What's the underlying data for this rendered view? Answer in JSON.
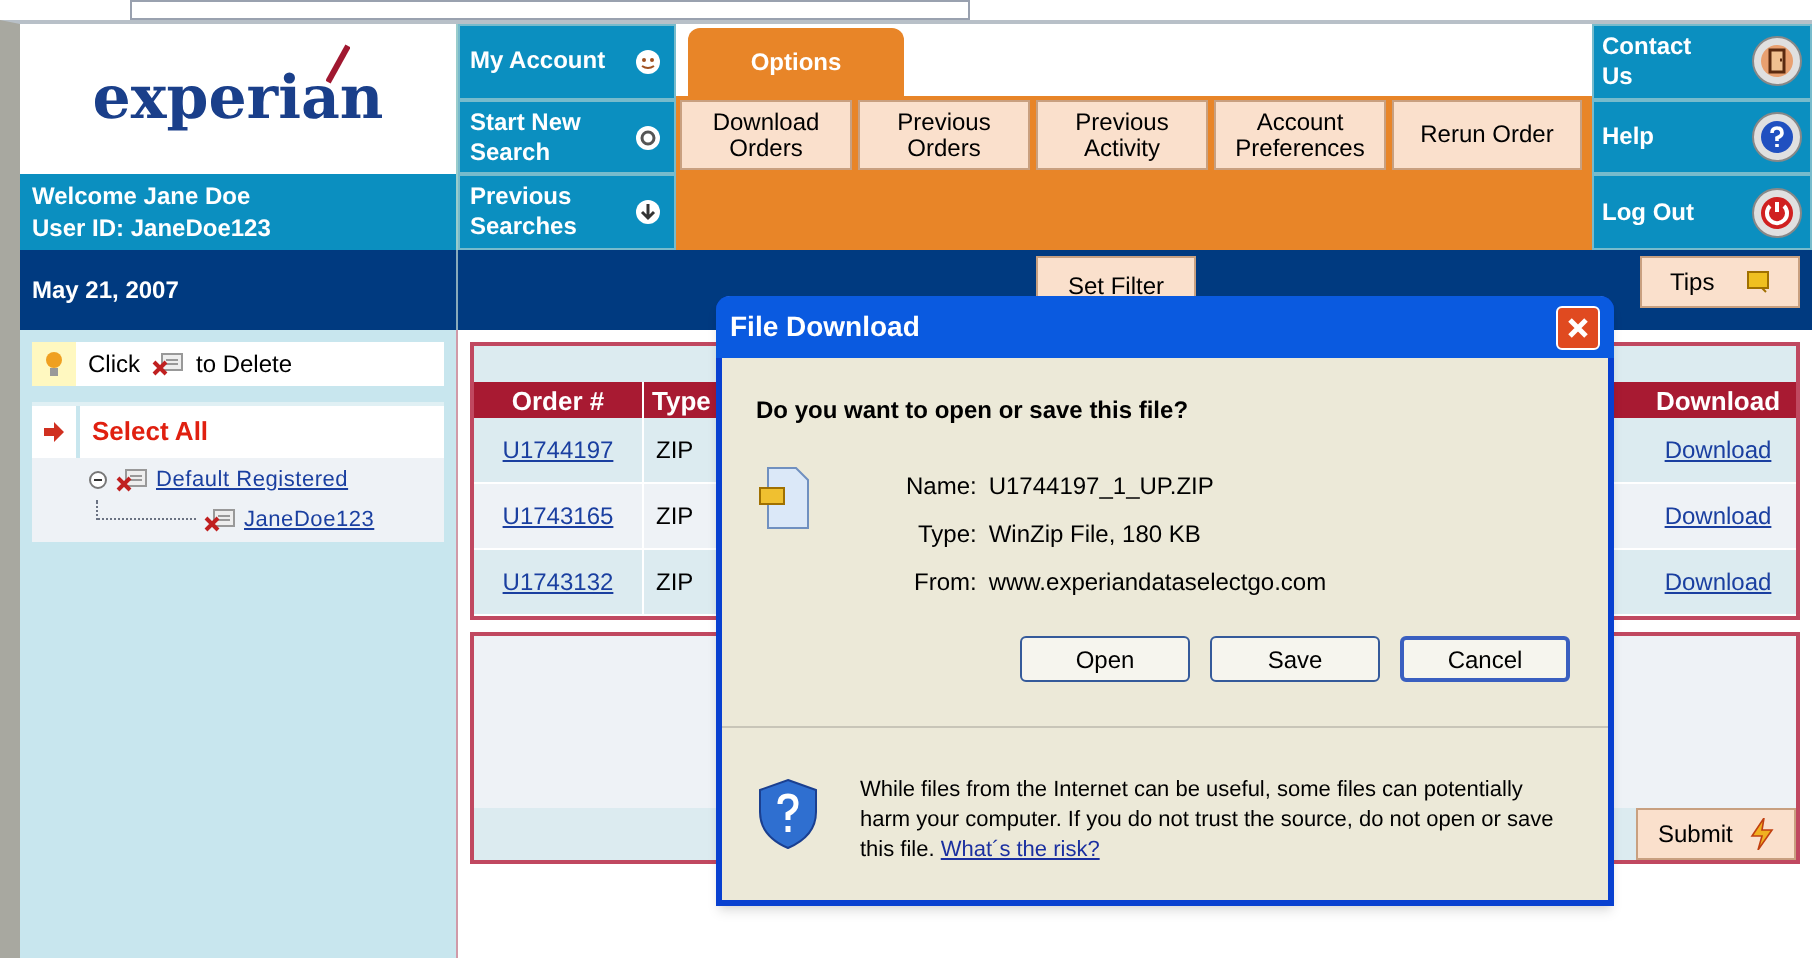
{
  "logo": {
    "text": "experian"
  },
  "user": {
    "welcome": "Welcome Jane Doe",
    "user_id": "User ID: JaneDoe123"
  },
  "nav": [
    {
      "label": "My Account",
      "kind": "smile"
    },
    {
      "label": "Start New Search",
      "kind": "target"
    },
    {
      "label": "Previous Searches",
      "kind": "down"
    }
  ],
  "options_tab": {
    "label": "Options",
    "selected": true
  },
  "option_buttons": [
    "Download Orders",
    "Previous Orders",
    "Previous Activity",
    "Account Preferences",
    "Rerun Order"
  ],
  "right_nav": [
    {
      "label": "Contact Us",
      "kind": "contact"
    },
    {
      "label": "Help",
      "kind": "help"
    },
    {
      "label": "Log Out",
      "kind": "power"
    }
  ],
  "date": "May 21, 2007",
  "set_filter": "Set Filter",
  "tips": "Tips",
  "hint": {
    "before": "Click",
    "after": "to Delete"
  },
  "select_all": "Select All",
  "tree": [
    {
      "label": "Default Registered",
      "expanded": true,
      "children": [
        {
          "label": "JaneDoe123"
        }
      ]
    }
  ],
  "table": {
    "columns": [
      "Order #",
      "Type",
      "Download"
    ],
    "rows": [
      {
        "order": "U1744197",
        "type": "ZIP",
        "download": "Download"
      },
      {
        "order": "U1743165",
        "type": "ZIP",
        "download": "Download"
      },
      {
        "order": "U1743132",
        "type": "ZIP",
        "download": "Download"
      }
    ]
  },
  "submit": "Submit",
  "dialog": {
    "title": "File Download",
    "question": "Do you want to open or save this file?",
    "fields": [
      {
        "label": "Name:",
        "value": "U1744197_1_UP.ZIP"
      },
      {
        "label": "Type:",
        "value": "WinZip File, 180 KB"
      },
      {
        "label": "From:",
        "value": "www.experiandataselectgo.com"
      }
    ],
    "buttons": [
      {
        "label": "Open",
        "focused": false
      },
      {
        "label": "Save",
        "focused": false
      },
      {
        "label": "Cancel",
        "focused": true
      }
    ],
    "warning": "While files from the Internet can be useful, some files can potentially harm your computer. If you do not trust the source, do not open or save this file.",
    "link": "What´s the risk?"
  }
}
